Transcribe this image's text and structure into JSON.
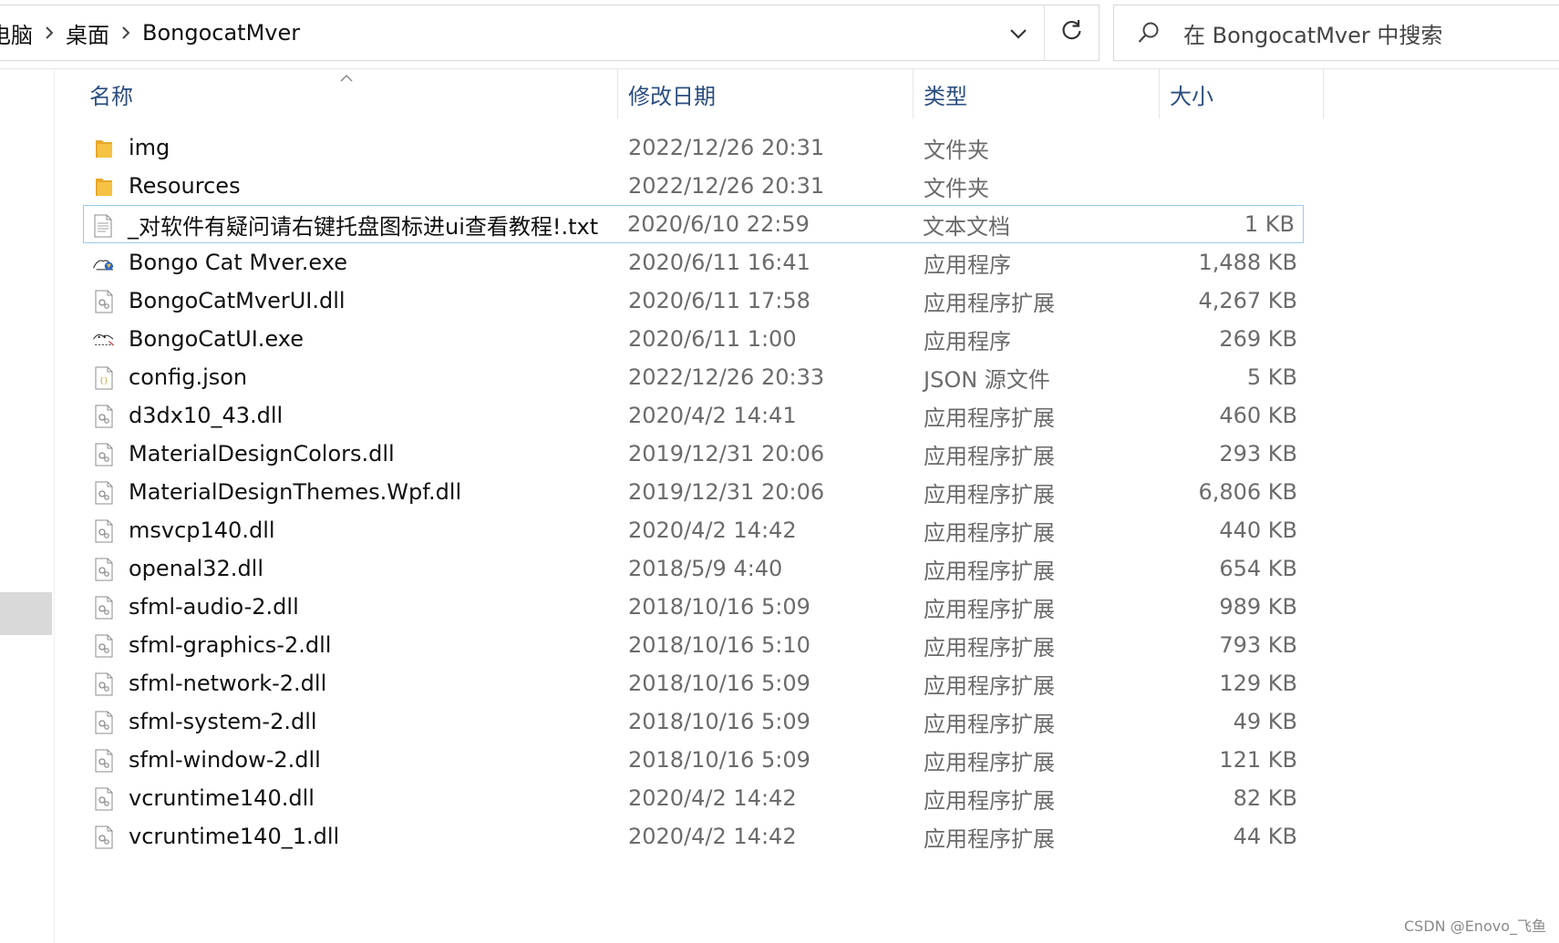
{
  "address_bar": {
    "breadcrumbs": [
      "电脑",
      "桌面",
      "BongocatMver"
    ]
  },
  "search": {
    "placeholder": "在 BongocatMver 中搜索"
  },
  "columns": {
    "name": "名称",
    "date": "修改日期",
    "type": "类型",
    "size": "大小"
  },
  "files": [
    {
      "name": "img",
      "date": "2022/12/26 20:31",
      "type": "文件夹",
      "size": "",
      "icon": "folder-icon"
    },
    {
      "name": "Resources",
      "date": "2022/12/26 20:31",
      "type": "文件夹",
      "size": "",
      "icon": "folder-icon"
    },
    {
      "name": "_对软件有疑问请右键托盘图标进ui查看教程!.txt",
      "date": "2020/6/10 22:59",
      "type": "文本文档",
      "size": "1 KB",
      "icon": "text-file-icon",
      "selected": true
    },
    {
      "name": "Bongo Cat Mver.exe",
      "date": "2020/6/11 16:41",
      "type": "应用程序",
      "size": "1,488 KB",
      "icon": "bongo-cat-exe-icon"
    },
    {
      "name": "BongoCatMverUI.dll",
      "date": "2020/6/11 17:58",
      "type": "应用程序扩展",
      "size": "4,267 KB",
      "icon": "dll-file-icon"
    },
    {
      "name": "BongoCatUI.exe",
      "date": "2020/6/11 1:00",
      "type": "应用程序",
      "size": "269 KB",
      "icon": "bongo-cat-ui-exe-icon"
    },
    {
      "name": "config.json",
      "date": "2022/12/26 20:33",
      "type": "JSON 源文件",
      "size": "5 KB",
      "icon": "json-file-icon"
    },
    {
      "name": "d3dx10_43.dll",
      "date": "2020/4/2 14:41",
      "type": "应用程序扩展",
      "size": "460 KB",
      "icon": "dll-file-icon"
    },
    {
      "name": "MaterialDesignColors.dll",
      "date": "2019/12/31 20:06",
      "type": "应用程序扩展",
      "size": "293 KB",
      "icon": "dll-file-icon"
    },
    {
      "name": "MaterialDesignThemes.Wpf.dll",
      "date": "2019/12/31 20:06",
      "type": "应用程序扩展",
      "size": "6,806 KB",
      "icon": "dll-file-icon"
    },
    {
      "name": "msvcp140.dll",
      "date": "2020/4/2 14:42",
      "type": "应用程序扩展",
      "size": "440 KB",
      "icon": "dll-file-icon"
    },
    {
      "name": "openal32.dll",
      "date": "2018/5/9 4:40",
      "type": "应用程序扩展",
      "size": "654 KB",
      "icon": "dll-file-icon"
    },
    {
      "name": "sfml-audio-2.dll",
      "date": "2018/10/16 5:09",
      "type": "应用程序扩展",
      "size": "989 KB",
      "icon": "dll-file-icon"
    },
    {
      "name": "sfml-graphics-2.dll",
      "date": "2018/10/16 5:10",
      "type": "应用程序扩展",
      "size": "793 KB",
      "icon": "dll-file-icon"
    },
    {
      "name": "sfml-network-2.dll",
      "date": "2018/10/16 5:09",
      "type": "应用程序扩展",
      "size": "129 KB",
      "icon": "dll-file-icon"
    },
    {
      "name": "sfml-system-2.dll",
      "date": "2018/10/16 5:09",
      "type": "应用程序扩展",
      "size": "49 KB",
      "icon": "dll-file-icon"
    },
    {
      "name": "sfml-window-2.dll",
      "date": "2018/10/16 5:09",
      "type": "应用程序扩展",
      "size": "121 KB",
      "icon": "dll-file-icon"
    },
    {
      "name": "vcruntime140.dll",
      "date": "2020/4/2 14:42",
      "type": "应用程序扩展",
      "size": "82 KB",
      "icon": "dll-file-icon"
    },
    {
      "name": "vcruntime140_1.dll",
      "date": "2020/4/2 14:42",
      "type": "应用程序扩展",
      "size": "44 KB",
      "icon": "dll-file-icon"
    }
  ],
  "colors": {
    "folder": "#f6c243",
    "selection_border": "#99c9ef",
    "header_text": "#2b4e7f"
  },
  "watermark": "CSDN @Enovo_飞鱼"
}
